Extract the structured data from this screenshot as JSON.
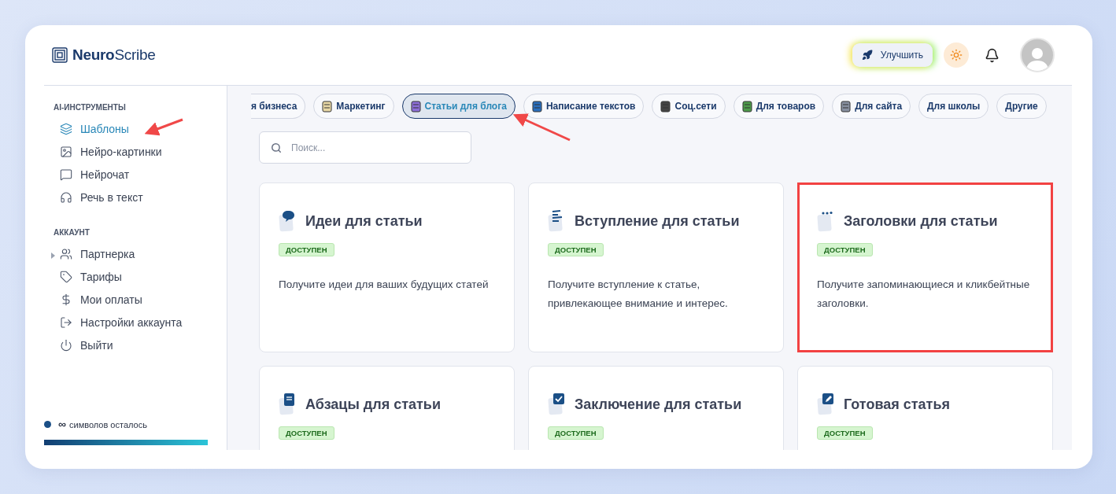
{
  "header": {
    "logo": "**Neuro**Scribe",
    "upgrade_button": "Улучшить"
  },
  "sidebar": {
    "sections": [
      {
        "title": "AI-ИНСТРУМЕНТЫ",
        "items": [
          {
            "label": "Шаблоны",
            "selected": true,
            "expandable": false
          },
          {
            "label": "Нейро-картинки",
            "selected": false,
            "expandable": false
          },
          {
            "label": "Нейрочат",
            "selected": false,
            "expandable": false
          },
          {
            "label": "Речь в текст",
            "selected": false,
            "expandable": false
          }
        ]
      },
      {
        "title": "АККАУНТ",
        "items": [
          {
            "label": "Партнерка",
            "selected": false,
            "expandable": true
          },
          {
            "label": "Тарифы",
            "selected": false,
            "expandable": false
          },
          {
            "label": "Мои оплаты",
            "selected": false,
            "expandable": false
          },
          {
            "label": "Настройки аккаунта",
            "selected": false,
            "expandable": false
          },
          {
            "label": "Выйти",
            "selected": false,
            "expandable": false
          }
        ]
      }
    ],
    "quota": {
      "amount": "∞",
      "label": "символов осталось",
      "level": 1,
      "color": "#1b4f86"
    }
  },
  "categories": [
    {
      "label": "я бизнеса",
      "selected": false,
      "clipped": true,
      "has_icon": false
    },
    {
      "label": "Маркетинг",
      "selected": false,
      "clipped": false,
      "has_icon": true
    },
    {
      "label": "Статьи для блога",
      "selected": true,
      "clipped": false,
      "has_icon": true
    },
    {
      "label": "Написание текстов",
      "selected": false,
      "clipped": false,
      "has_icon": true
    },
    {
      "label": "Соц.сети",
      "selected": false,
      "clipped": false,
      "has_icon": true
    },
    {
      "label": "Для товаров",
      "selected": false,
      "clipped": false,
      "has_icon": true
    },
    {
      "label": "Для сайта",
      "selected": false,
      "clipped": false,
      "has_icon": true
    },
    {
      "label": "Для школы",
      "selected": false,
      "clipped": false,
      "has_icon": false
    },
    {
      "label": "Другие",
      "selected": false,
      "clipped": false,
      "has_icon": false
    }
  ],
  "search": {
    "placeholder": "Поиск..."
  },
  "cards": [
    {
      "title": "Идеи для статьи",
      "badge": "ДОСТУПЕН",
      "description": "Получите идеи для ваших будущих статей",
      "highlighted": false
    },
    {
      "title": "Вступление для статьи",
      "badge": "ДОСТУПЕН",
      "description": "Получите вступление к статье, привлекающее внимание и интерес.",
      "highlighted": false
    },
    {
      "title": "Заголовки для статьи",
      "badge": "ДОСТУПЕН",
      "description": "Получите запоминающиеся и кликбейтные заголовки.",
      "highlighted": true
    },
    {
      "title": "Абзацы для статьи",
      "badge": "ДОСТУПЕН",
      "highlighted": false
    },
    {
      "title": "Заключение для статьи",
      "badge": "ДОСТУПЕН",
      "highlighted": false
    },
    {
      "title": "Готовая статья",
      "badge": "ДОСТУПЕН",
      "highlighted": false
    }
  ]
}
